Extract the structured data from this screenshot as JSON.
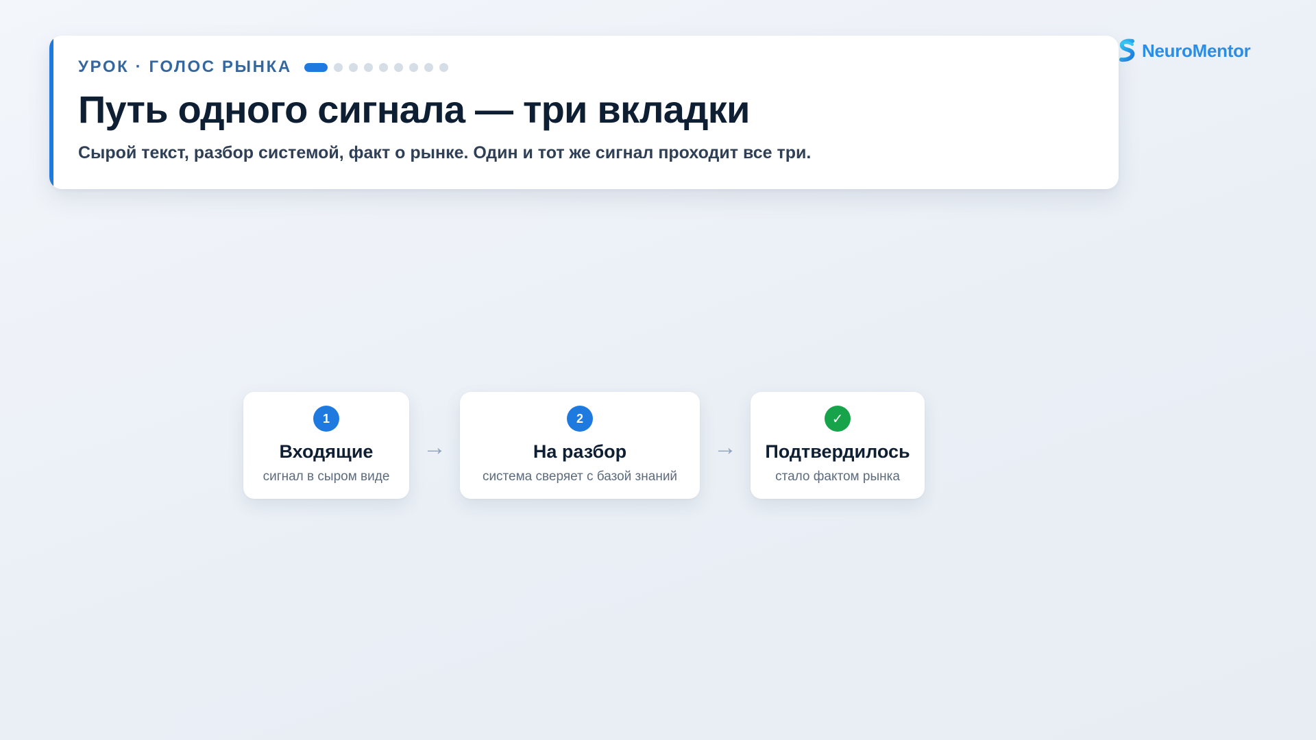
{
  "brand": {
    "name": "NeuroMentor",
    "icon": "neuromentor-logo-icon",
    "color": "#2a8ee6"
  },
  "header": {
    "eyebrow": "УРОК · ГОЛОС РЫНКА",
    "title": "Путь одного сигнала — три вкладки",
    "subtitle": "Сырой текст, разбор системой, факт о рынке. Один и тот же сигнал проходит все три.",
    "progress": {
      "current": 1,
      "total": 9
    },
    "accent_color": "#1f7ae0"
  },
  "flow": {
    "steps": [
      {
        "badge": "1",
        "title": "Входящие",
        "description": "сигнал в сыром виде",
        "status": "step"
      },
      {
        "badge": "2",
        "title": "На разбор",
        "description": "система сверяет с базой знаний",
        "status": "step"
      },
      {
        "badge": "✓",
        "title": "Подтвердилось",
        "description": "стало фактом рынка",
        "status": "done"
      }
    ],
    "arrow_icon": "→",
    "colors": {
      "step": "#1f7ae0",
      "done": "#16a34a"
    }
  }
}
